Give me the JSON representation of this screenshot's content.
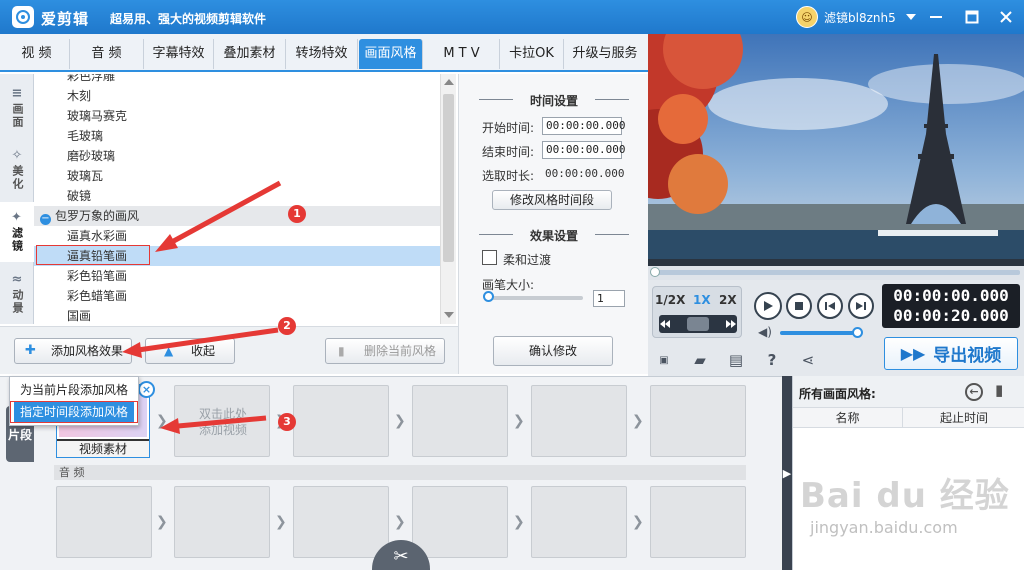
{
  "app": {
    "name": "爱剪辑",
    "slogan": "超易用、强大的视频剪辑软件",
    "username": "滤镜bl8znh5"
  },
  "tabs": [
    {
      "label": "视 频"
    },
    {
      "label": "音 频"
    },
    {
      "label": "字幕特效"
    },
    {
      "label": "叠加素材"
    },
    {
      "label": "转场特效"
    },
    {
      "label": "画面风格"
    },
    {
      "label": "M T V"
    },
    {
      "label": "卡拉OK"
    },
    {
      "label": "升级与服务"
    }
  ],
  "rail": [
    {
      "label": "画面"
    },
    {
      "label": "美化"
    },
    {
      "label": "滤镜"
    },
    {
      "label": "动景"
    }
  ],
  "list": {
    "items": [
      {
        "label": "彩色浮雕"
      },
      {
        "label": "木刻"
      },
      {
        "label": "玻璃马赛克"
      },
      {
        "label": "毛玻璃"
      },
      {
        "label": "磨砂玻璃"
      },
      {
        "label": "玻璃瓦"
      },
      {
        "label": "破镜"
      },
      {
        "label": "包罗万象的画风"
      },
      {
        "label": "逼真水彩画"
      },
      {
        "label": "逼真铅笔画"
      },
      {
        "label": "彩色铅笔画"
      },
      {
        "label": "彩色蜡笔画"
      },
      {
        "label": "国画"
      }
    ]
  },
  "settings": {
    "time_title": "时间设置",
    "start_label": "开始时间:",
    "start_value": "00:00:00.000",
    "end_label": "结束时间:",
    "end_value": "00:00:00.000",
    "duration_label": "选取时长:",
    "duration_value": "00:00:00.000",
    "modify_time_button": "修改风格时间段",
    "effect_title": "效果设置",
    "fade_label": "柔和过渡",
    "brush_label": "画笔大小:",
    "brush_value": "1",
    "confirm_button": "确认修改"
  },
  "actions": {
    "add_button": "添加风格效果",
    "collapse_button": "收起",
    "delete_button": "删除当前风格"
  },
  "popup": {
    "item1": "为当前片段添加风格",
    "item2": "指定时间段添加风格"
  },
  "player": {
    "speed_half": "1/2X",
    "speed_1x": "1X",
    "speed_2x": "2X",
    "time_current": "00:00:00.000",
    "time_total": "00:00:20.000",
    "export_button": "导出视频"
  },
  "timeline": {
    "side_tab": "片段",
    "clip_label": "视频素材",
    "empty_hint_line1": "双击此处",
    "empty_hint_line2": "添加视频",
    "audio_label": "音 频"
  },
  "right_panel": {
    "title": "所有画面风格:",
    "col_name": "名称",
    "col_time": "起止时间"
  },
  "annotations": {
    "badge1": "1",
    "badge2": "2",
    "badge3": "3"
  },
  "watermark": {
    "line1": "Bai du 经验",
    "line2": "jingyan.baidu.com"
  },
  "colors": {
    "accent": "#2e8fe0",
    "annotation": "#e53935"
  }
}
